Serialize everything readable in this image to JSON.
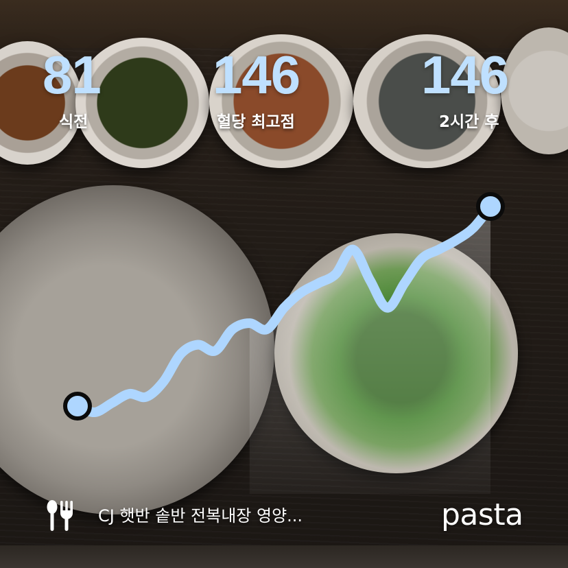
{
  "stats": [
    {
      "value": "81",
      "label": "식전"
    },
    {
      "value": "146",
      "label": "혈당 최고점"
    },
    {
      "value": "146",
      "label": "2시간 후"
    }
  ],
  "footer": {
    "food_name": "CJ 햇반 솥반 전복내장 영양...",
    "food_icon": "fork-spoon-icon",
    "brand": "pasta"
  },
  "colors": {
    "accent": "#bfe0ff",
    "line": "#aed6ff",
    "marker_stroke": "#0b0b0b",
    "text": "#ffffff"
  },
  "chart_data": {
    "type": "line",
    "title": "",
    "xlabel": "",
    "ylabel": "",
    "grid": false,
    "series": [
      {
        "values": [
          81,
          79,
          82,
          85,
          84,
          89,
          98,
          101,
          99,
          106,
          108,
          106,
          113,
          118,
          121,
          124,
          132,
          122,
          113,
          121,
          129,
          132,
          135,
          139,
          146
        ]
      }
    ],
    "start_value": 81,
    "end_value": 146
  }
}
